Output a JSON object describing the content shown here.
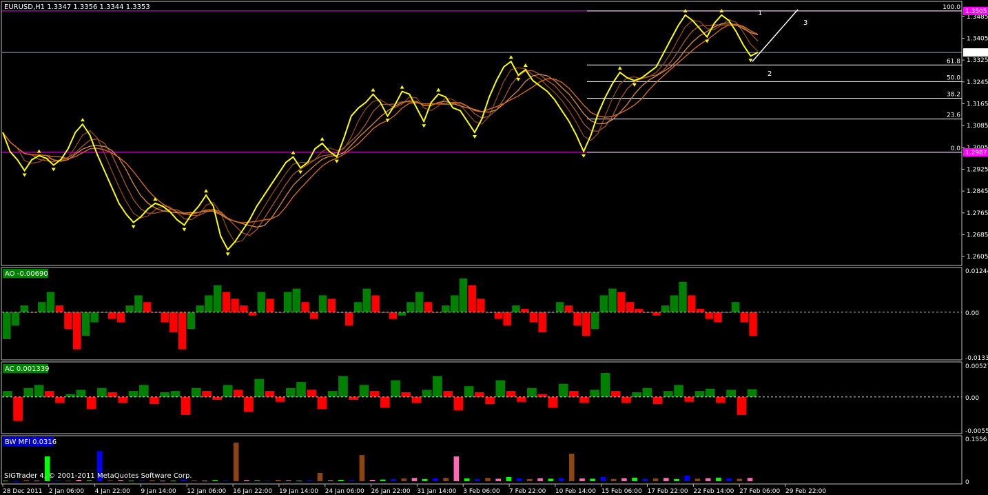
{
  "chart_data": [
    {
      "type": "line",
      "title": "EURUSD,H1  1.3347 1.3356 1.3344 1.3353",
      "ylim": [
        1.2575,
        1.3535
      ],
      "y_ticks": [
        "1.3485",
        "1.3405",
        "1.3325",
        "1.3245",
        "1.3165",
        "1.3085",
        "1.3005",
        "1.2925",
        "1.2845",
        "1.2765",
        "1.2685",
        "1.2605"
      ],
      "x_ticks": [
        "28 Dec 2011",
        "2 Jan 06:00",
        "4 Jan 22:00",
        "9 Jan 14:00",
        "12 Jan 06:00",
        "16 Jan 22:00",
        "19 Jan 14:00",
        "24 Jan 06:00",
        "26 Jan 22:00",
        "31 Jan 14:00",
        "3 Feb 06:00",
        "7 Feb 22:00",
        "10 Feb 14:00",
        "15 Feb 06:00",
        "17 Feb 22:00",
        "22 Feb 14:00",
        "27 Feb 06:00",
        "29 Feb 22:00"
      ],
      "current_price": "1.3353",
      "upper_level": "1.3505",
      "lower_level": "1.2987",
      "fibonacci": [
        {
          "level": "100.0",
          "price": 1.3505
        },
        {
          "level": "61.8",
          "price": 1.3307
        },
        {
          "level": "50.0",
          "price": 1.3246
        },
        {
          "level": "38.2",
          "price": 1.3185
        },
        {
          "level": "23.6",
          "price": 1.3109
        },
        {
          "level": "0.0",
          "price": 1.2987
        }
      ],
      "wave_labels": [
        "1",
        "2",
        "3"
      ],
      "series": [
        {
          "values": [
            1.306,
            1.299,
            1.296,
            1.292,
            1.296,
            1.2975,
            1.2965,
            1.294,
            1.296,
            1.3,
            1.306,
            1.309,
            1.305,
            1.298,
            1.292,
            1.286,
            1.28,
            1.276,
            1.273,
            1.275,
            1.278,
            1.28,
            1.279,
            1.277,
            1.274,
            1.272,
            1.276,
            1.279,
            1.283,
            1.279,
            1.268,
            1.263,
            1.266,
            1.27,
            1.274,
            1.279,
            1.283,
            1.287,
            1.291,
            1.295,
            1.297,
            1.293,
            1.295,
            1.3,
            1.302,
            1.299,
            1.297,
            1.304,
            1.312,
            1.315,
            1.317,
            1.32,
            1.317,
            1.312,
            1.316,
            1.321,
            1.32,
            1.315,
            1.31,
            1.317,
            1.32,
            1.319,
            1.315,
            1.314,
            1.31,
            1.306,
            1.311,
            1.319,
            1.325,
            1.33,
            1.332,
            1.327,
            1.329,
            1.325,
            1.323,
            1.321,
            1.318,
            1.314,
            1.31,
            1.305,
            1.299,
            1.305,
            1.313,
            1.319,
            1.324,
            1.328,
            1.326,
            1.325,
            1.326,
            1.328,
            1.33,
            1.335,
            1.34,
            1.345,
            1.349,
            1.347,
            1.344,
            1.341,
            1.346,
            1.349,
            1.347,
            1.343,
            1.338,
            1.334,
            1.3353
          ]
        }
      ]
    },
    {
      "type": "bar",
      "title": "AO -0.00690",
      "ylim": [
        -0.01332,
        0.01244
      ],
      "y_ticks": [
        "0.01244",
        "0.00",
        "-0.01332"
      ],
      "values": [
        -0.008,
        -0.004,
        0.002,
        0.0,
        0.003,
        0.006,
        0.002,
        -0.005,
        -0.011,
        -0.007,
        -0.003,
        0.0,
        -0.002,
        -0.003,
        0.002,
        0.005,
        0.003,
        0.0,
        -0.003,
        -0.006,
        -0.011,
        -0.005,
        0.002,
        0.005,
        0.008,
        0.006,
        0.004,
        0.002,
        -0.001,
        0.006,
        0.004,
        0.0,
        0.006,
        0.007,
        0.003,
        -0.002,
        0.005,
        0.004,
        0.0,
        -0.004,
        0.003,
        0.007,
        0.005,
        0.0,
        -0.002,
        -0.001,
        0.003,
        0.006,
        0.003,
        0.0,
        0.002,
        0.005,
        0.01,
        0.008,
        0.004,
        0.0,
        -0.002,
        -0.004,
        0.002,
        0.001,
        -0.003,
        -0.006,
        0.0,
        0.003,
        0.002,
        -0.004,
        -0.007,
        -0.005,
        0.005,
        0.007,
        0.006,
        0.003,
        0.001,
        0.0,
        -0.001,
        0.002,
        0.005,
        0.009,
        0.005,
        0.001,
        -0.002,
        -0.003,
        0.0,
        0.003,
        -0.003,
        -0.007
      ],
      "colors": {
        "up": "#008000",
        "down": "#ff0000"
      }
    },
    {
      "type": "bar",
      "title": "AC 0.001339",
      "ylim": [
        -0.00554,
        0.00527
      ],
      "y_ticks": [
        "0.00527",
        "0.00",
        "-0.00554"
      ],
      "values": [
        0.001,
        -0.004,
        0.0015,
        0.002,
        0.001,
        -0.001,
        0.0005,
        0.0012,
        -0.002,
        0.0015,
        0.0008,
        -0.001,
        0.001,
        0.002,
        -0.0012,
        0.0008,
        0.001,
        -0.003,
        0.0015,
        0.001,
        -0.0005,
        0.002,
        0.0012,
        -0.0025,
        0.003,
        0.001,
        -0.0008,
        0.0015,
        0.0025,
        0.0012,
        -0.002,
        0.001,
        0.0035,
        -0.0005,
        0.002,
        0.001,
        -0.0018,
        0.0028,
        0.0008,
        -0.001,
        0.0012,
        0.0035,
        0.001,
        -0.0022,
        0.0018,
        0.0008,
        -0.0012,
        0.0028,
        0.001,
        -0.0008,
        0.0015,
        0.0005,
        -0.0018,
        0.0022,
        0.001,
        -0.001,
        0.0012,
        0.004,
        0.001,
        -0.001,
        0.0008,
        0.0015,
        -0.0012,
        0.001,
        0.002,
        -0.0008,
        0.001,
        0.0014,
        -0.001,
        0.0012,
        -0.003,
        0.0013
      ],
      "colors": {
        "up": "#008000",
        "down": "#ff0000"
      }
    },
    {
      "type": "bar",
      "title": "BW MFI 0.0316",
      "ylim": [
        0,
        0.1556
      ],
      "y_ticks": [
        "0.1556",
        "0"
      ],
      "values": [
        0.002,
        0.001,
        0.004,
        0.002,
        0.09,
        0.003,
        0.002,
        0.005,
        0.003,
        0.11,
        0.003,
        0.004,
        0.002,
        0.003,
        0.004,
        0.002,
        0.002,
        0.006,
        0.003,
        0.002,
        0.004,
        0.003,
        0.14,
        0.004,
        0.003,
        0.002,
        0.005,
        0.003,
        0.002,
        0.004,
        0.03,
        0.003,
        0.005,
        0.004,
        0.095,
        0.005,
        0.006,
        0.008,
        0.01,
        0.012,
        0.008,
        0.01,
        0.012,
        0.09,
        0.01,
        0.008,
        0.012,
        0.009,
        0.015,
        0.01,
        0.008,
        0.011,
        0.009,
        0.012,
        0.1,
        0.01,
        0.009,
        0.015,
        0.008,
        0.011,
        0.013,
        0.009,
        0.01,
        0.012,
        0.008,
        0.02,
        0.009,
        0.011,
        0.013,
        0.01,
        0.009,
        0.012
      ],
      "colors": {
        "bar": "#00ff00"
      }
    }
  ],
  "watermark": "SIGTrader 4, © 2001-2011 MetaQuotes Software Corp."
}
